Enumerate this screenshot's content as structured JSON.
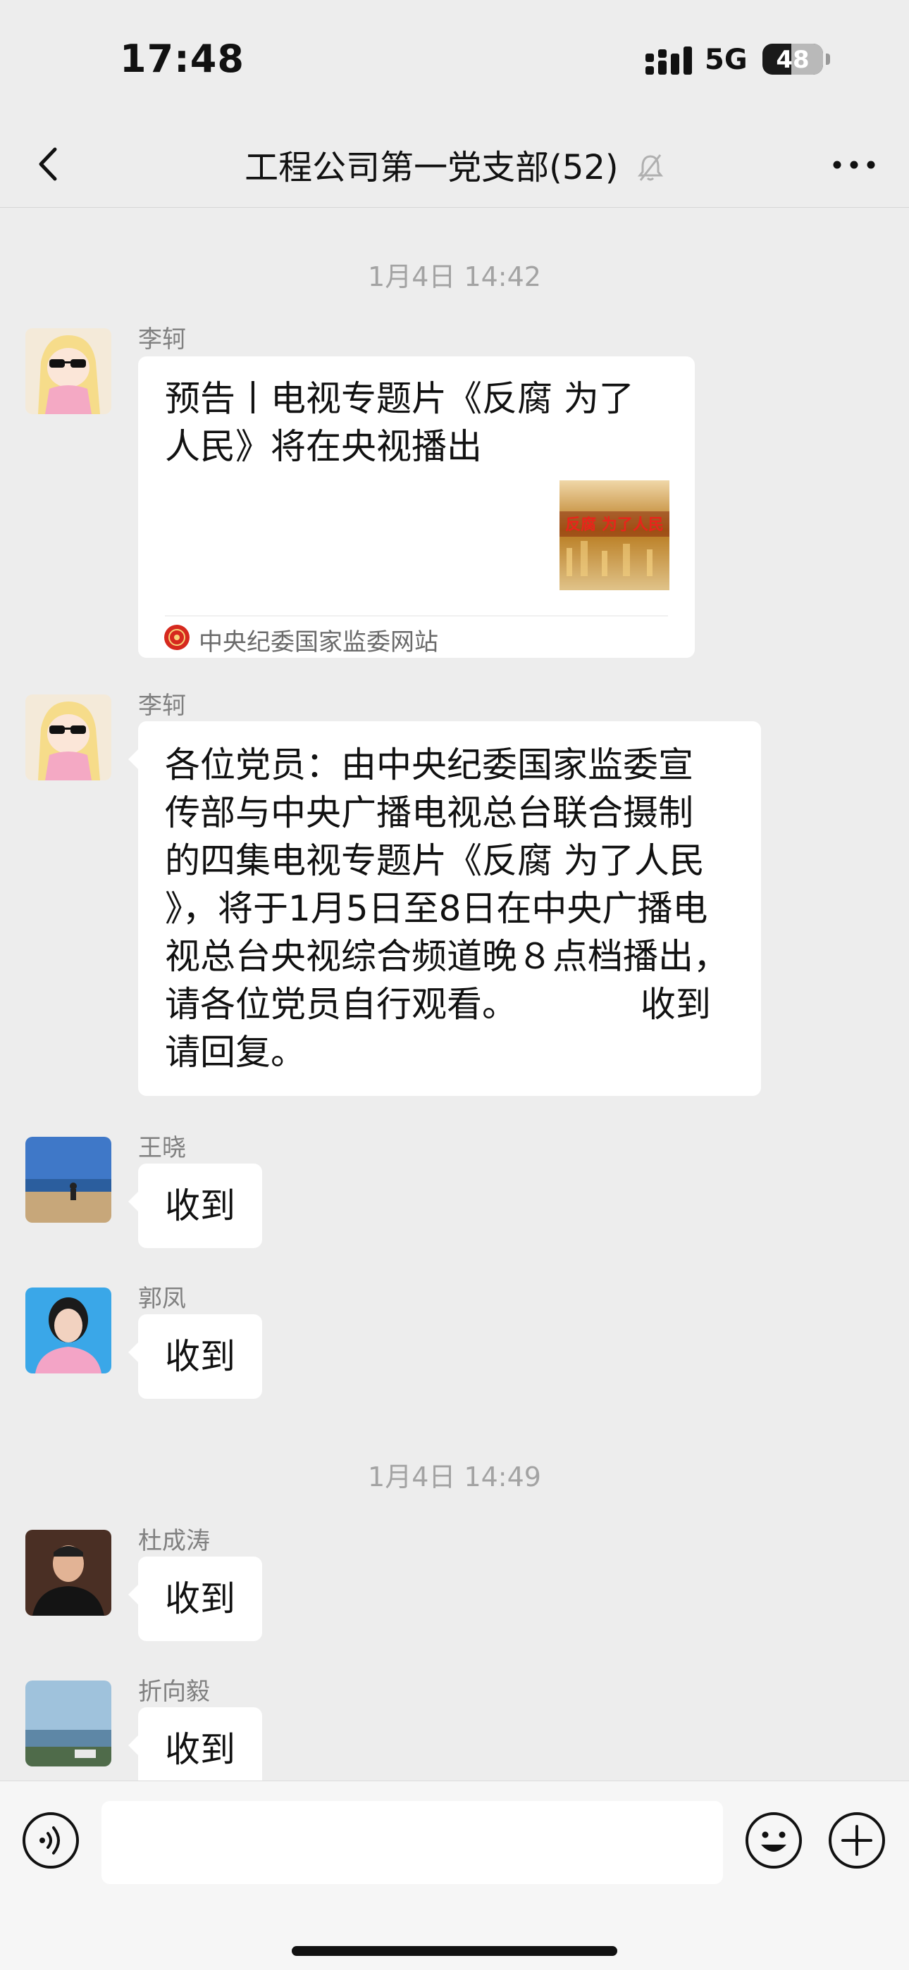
{
  "status_bar": {
    "time": "17:48",
    "network": "5G",
    "battery": "48",
    "battery_level_percent": 48
  },
  "header": {
    "title": "工程公司第一党支部(52)",
    "back_icon": "chevron-left-icon",
    "mute_icon": "bell-off-icon",
    "more_icon": "more-dots-icon"
  },
  "timestamps": [
    "1月4日 14:42",
    "1月4日 14:49"
  ],
  "messages": [
    {
      "sender": "李轲",
      "type": "link_card",
      "title_lines": [
        "预告丨电视专题片《反腐 为了",
        "人民》将在央视播出"
      ],
      "thumb_text": "反腐 为了人民",
      "source": "中央纪委国家监委网站"
    },
    {
      "sender": "李轲",
      "type": "text",
      "lines": [
        "各位党员：由中央纪委国家监委宣",
        "传部与中央广播电视总台联合摄制",
        "的四集电视专题片《反腐 为了人民",
        "》，将于1月5日至8日在中央广播电",
        "视总台央视综合频道晚８点档播出，",
        "请各位党员自行观看。           收到",
        "请回复。"
      ]
    },
    {
      "sender": "王晓",
      "type": "text",
      "text": "收到"
    },
    {
      "sender": "郭凤",
      "type": "text",
      "text": "收到"
    },
    {
      "sender": "杜成涛",
      "type": "text",
      "text": "收到"
    },
    {
      "sender": "折向毅",
      "type": "text",
      "text": "收到"
    }
  ],
  "input_bar": {
    "placeholder": "",
    "voice_icon": "voice-icon",
    "emoji_icon": "emoji-icon",
    "plus_icon": "plus-icon"
  },
  "colors": {
    "background": "#ededed",
    "bubble": "#ffffff",
    "timestamp": "#a3a3a3",
    "sender": "#808080"
  }
}
